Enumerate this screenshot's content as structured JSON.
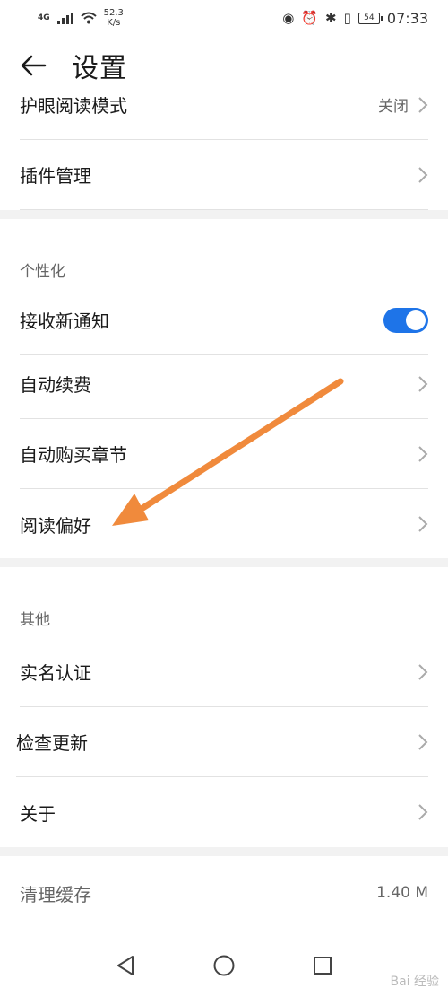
{
  "status_bar": {
    "network": "4G",
    "speed_value": "52.3",
    "speed_unit": "K/s",
    "battery": "54",
    "time": "07:33"
  },
  "header": {
    "title": "设置"
  },
  "group1": {
    "rows": [
      {
        "label": "护眼阅读模式",
        "value": "关闭"
      },
      {
        "label": "插件管理"
      }
    ]
  },
  "personalization": {
    "title": "个性化",
    "receive_notifications": {
      "label": "接收新通知",
      "enabled": true
    },
    "rows": [
      {
        "label": "自动续费"
      },
      {
        "label": "自动购买章节"
      },
      {
        "label": "阅读偏好"
      }
    ]
  },
  "other": {
    "title": "其他",
    "rows": [
      {
        "label": "实名认证"
      },
      {
        "label": "检查更新"
      },
      {
        "label": "关于"
      }
    ]
  },
  "cache": {
    "label": "清理缓存",
    "value": "1.40 M"
  },
  "watermark": "Bai 经验",
  "colors": {
    "accent": "#1e74e8",
    "annotation_arrow": "#f08a3c"
  },
  "nav_icons": [
    "back-triangle-icon",
    "home-circle-icon",
    "recents-square-icon"
  ]
}
